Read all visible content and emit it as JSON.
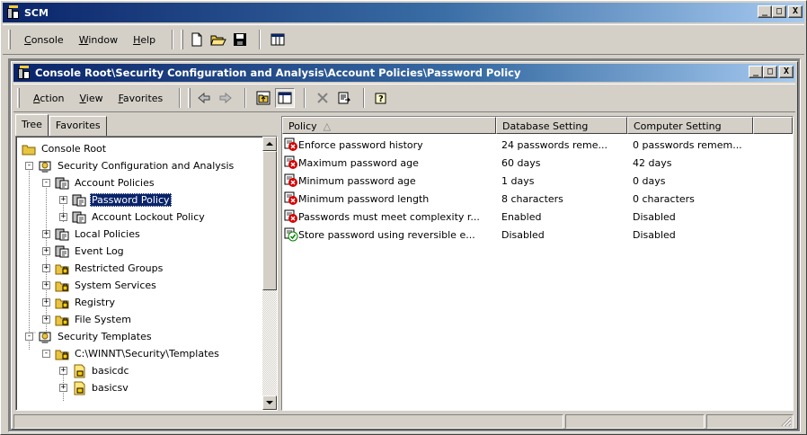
{
  "app": {
    "title": "SCM",
    "buttons": {
      "minimize": "_",
      "maximize": "□",
      "close": "X"
    }
  },
  "menu": [
    {
      "label": "Console",
      "underline": "C",
      "rest": "onsole"
    },
    {
      "label": "Window",
      "underline": "W",
      "rest": "indow"
    },
    {
      "label": "Help",
      "underline": "H",
      "rest": "elp"
    }
  ],
  "main_toolbar_icons": [
    "new-icon",
    "open-folder-icon",
    "save-icon",
    "new-window-icon"
  ],
  "child": {
    "title": "Console Root\\Security Configuration and Analysis\\Account Policies\\Password Policy",
    "menu": [
      {
        "label": "Action",
        "underline": "A",
        "rest": "ction"
      },
      {
        "label": "View",
        "underline": "V",
        "rest": "iew"
      },
      {
        "label": "Favorites",
        "underline": "F",
        "rest": "avorites"
      }
    ],
    "toolbar_icons": [
      "back-arrow-icon",
      "forward-arrow-icon",
      "up-folder-icon",
      "show-hide-tree-icon",
      "delete-icon",
      "export-list-icon",
      "help-icon"
    ]
  },
  "tabs": {
    "tree": "Tree",
    "favorites": "Favorites"
  },
  "tree": [
    {
      "label": "Console Root",
      "level": 0,
      "expander": "",
      "icon": "folder-icon"
    },
    {
      "label": "Security Configuration and Analysis",
      "level": 1,
      "expander": "-",
      "icon": "security-config-icon"
    },
    {
      "label": "Account Policies",
      "level": 2,
      "expander": "-",
      "icon": "policy-folder-icon"
    },
    {
      "label": "Password Policy",
      "level": 3,
      "expander": "+",
      "icon": "policy-folder-icon",
      "selected": true
    },
    {
      "label": "Account Lockout Policy",
      "level": 3,
      "expander": "+",
      "icon": "policy-folder-icon"
    },
    {
      "label": "Local Policies",
      "level": 2,
      "expander": "+",
      "icon": "policy-folder-icon"
    },
    {
      "label": "Event Log",
      "level": 2,
      "expander": "+",
      "icon": "policy-folder-icon"
    },
    {
      "label": "Restricted Groups",
      "level": 2,
      "expander": "+",
      "icon": "locked-folder-icon"
    },
    {
      "label": "System Services",
      "level": 2,
      "expander": "+",
      "icon": "locked-folder-icon"
    },
    {
      "label": "Registry",
      "level": 2,
      "expander": "+",
      "icon": "locked-folder-icon"
    },
    {
      "label": "File System",
      "level": 2,
      "expander": "+",
      "icon": "locked-folder-icon"
    },
    {
      "label": "Security Templates",
      "level": 1,
      "expander": "-",
      "icon": "security-config-icon"
    },
    {
      "label": "C:\\WINNT\\Security\\Templates",
      "level": 2,
      "expander": "-",
      "icon": "locked-folder-icon"
    },
    {
      "label": "basicdc",
      "level": 3,
      "expander": "+",
      "icon": "template-icon"
    },
    {
      "label": "basicsv",
      "level": 3,
      "expander": "+",
      "icon": "template-icon"
    }
  ],
  "list": {
    "columns": [
      "Policy",
      "Database Setting",
      "Computer Setting"
    ],
    "sort_indicator": "△",
    "rows": [
      {
        "policy": "Enforce password history",
        "database": "24 passwords reme...",
        "computer": "0 passwords remem...",
        "status": "mismatch"
      },
      {
        "policy": "Maximum password age",
        "database": "60 days",
        "computer": "42 days",
        "status": "mismatch"
      },
      {
        "policy": "Minimum password age",
        "database": "1 days",
        "computer": "0 days",
        "status": "mismatch"
      },
      {
        "policy": "Minimum password length",
        "database": "8 characters",
        "computer": "0 characters",
        "status": "mismatch"
      },
      {
        "policy": "Passwords must meet complexity r...",
        "database": "Enabled",
        "computer": "Disabled",
        "status": "mismatch"
      },
      {
        "policy": "Store password using reversible e...",
        "database": "Disabled",
        "computer": "Disabled",
        "status": "match"
      }
    ]
  }
}
